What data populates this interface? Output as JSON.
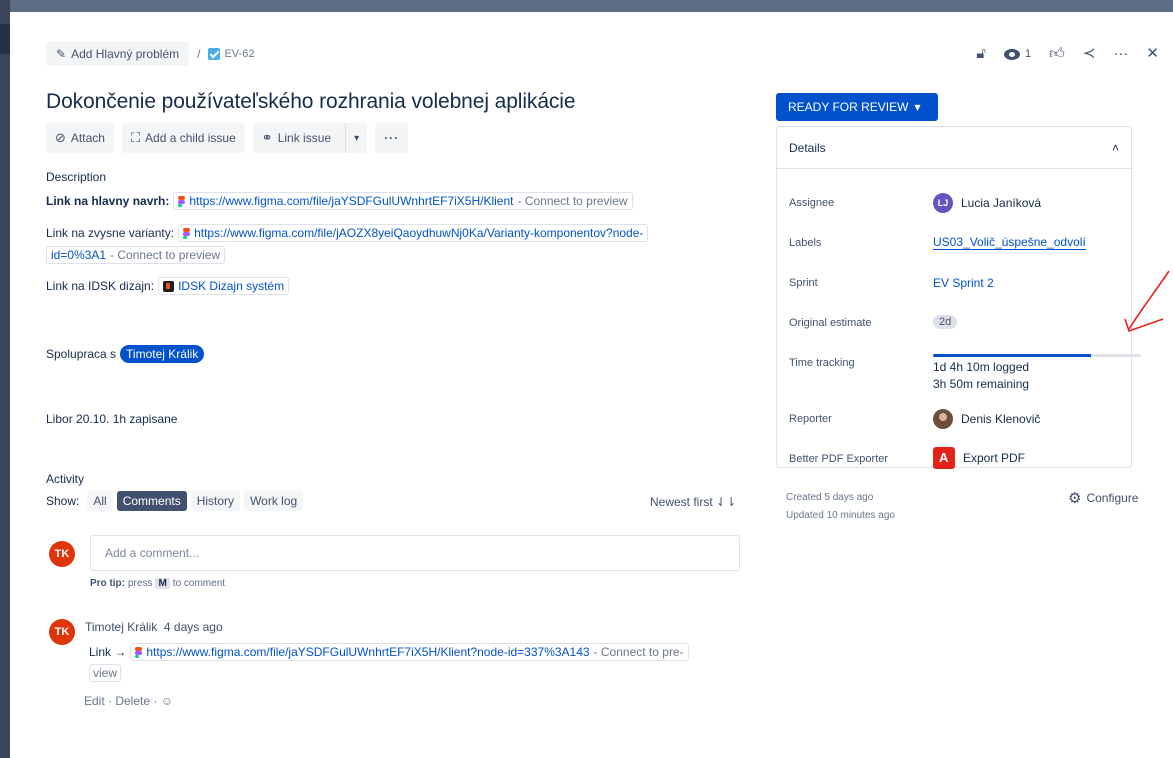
{
  "breadcrumb": {
    "parent_label": "Add Hlavný problém",
    "separator": "/",
    "issue_key": "EV-62"
  },
  "top_actions": {
    "watch_count": "1"
  },
  "issue": {
    "title": "Dokončenie používateľského rozhrania volebnej aplikácie"
  },
  "toolbar": {
    "attach": "Attach",
    "add_child": "Add a child issue",
    "link_issue": "Link issue",
    "more": "···"
  },
  "description": {
    "label": "Description",
    "line1_label": "Link na hlavny navrh:",
    "line1_url": "https://www.figma.com/file/jaYSDFGulUWnhrtEF7iX5H/Klient",
    "line1_preview": "- Connect to preview",
    "line2_label": "Link na zvysne varianty:",
    "line2_url_a": "https://www.figma.com/file/jAOZX8yeiQaoydhuwNj0Ka/Varianty-komponentov?node-",
    "line2_url_b": "id=0%3A1",
    "line2_preview": "- Connect to preview",
    "line3_label": "Link na IDSK dizajn:",
    "line3_link": "IDSK Dizajn systém",
    "spolupraca_label": "Spolupraca s",
    "spolupraca_mention": "Timotej Králik",
    "note": "Libor 20.10. 1h zapisane"
  },
  "activity": {
    "label": "Activity",
    "show_label": "Show:",
    "filters": [
      "All",
      "Comments",
      "History",
      "Work log"
    ],
    "active_filter": "Comments",
    "sort": "Newest first ⇃⇂"
  },
  "composer": {
    "avatar": "TK",
    "placeholder": "Add a comment...",
    "protip_label": "Pro tip:",
    "protip_press": "press",
    "protip_key": "M",
    "protip_rest": "to comment"
  },
  "comment": {
    "avatar": "TK",
    "author": "Timotej Králik",
    "time": "4 days ago",
    "link_prefix": "Link →",
    "url": "https://www.figma.com/file/jaYSDFGulUWnhrtEF7iX5H/Klient?node-id=337%3A143",
    "preview": "- Connect to pre-",
    "preview_cont": "view",
    "actions": "Edit · Delete · ☺"
  },
  "status": {
    "label": "READY FOR REVIEW"
  },
  "details": {
    "title": "Details",
    "assignee_label": "Assignee",
    "assignee_initials": "LJ",
    "assignee": "Lucia Janíková",
    "labels_label": "Labels",
    "labels_value": "US03_Volič_úspešne_odvolí",
    "sprint_label": "Sprint",
    "sprint_value": "EV Sprint 2",
    "estimate_label": "Original estimate",
    "estimate_value": "2d",
    "tracking_label": "Time tracking",
    "tracking_fraction": 0.76,
    "logged": "1d 4h 10m logged",
    "remaining": "3h 50m remaining",
    "reporter_label": "Reporter",
    "reporter": "Denis Klenovič",
    "pdf_label": "Better PDF Exporter",
    "pdf_value": "Export PDF"
  },
  "meta": {
    "created": "Created 5 days ago",
    "updated": "Updated 10 minutes ago",
    "configure": "Configure"
  },
  "colors": {
    "primary": "#0052cc",
    "annotation": "#e8221b",
    "avatar_tk": "#de350b",
    "avatar_lj": "#6554c0"
  }
}
